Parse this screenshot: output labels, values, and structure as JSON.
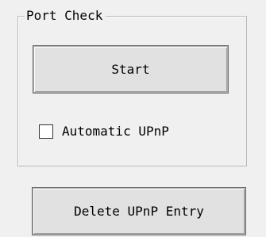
{
  "port_check": {
    "group_title": "Port Check",
    "start_label": "Start",
    "automatic_upnp": {
      "label": "Automatic UPnP",
      "checked": false
    }
  },
  "delete_upnp_label": "Delete UPnP Entry"
}
